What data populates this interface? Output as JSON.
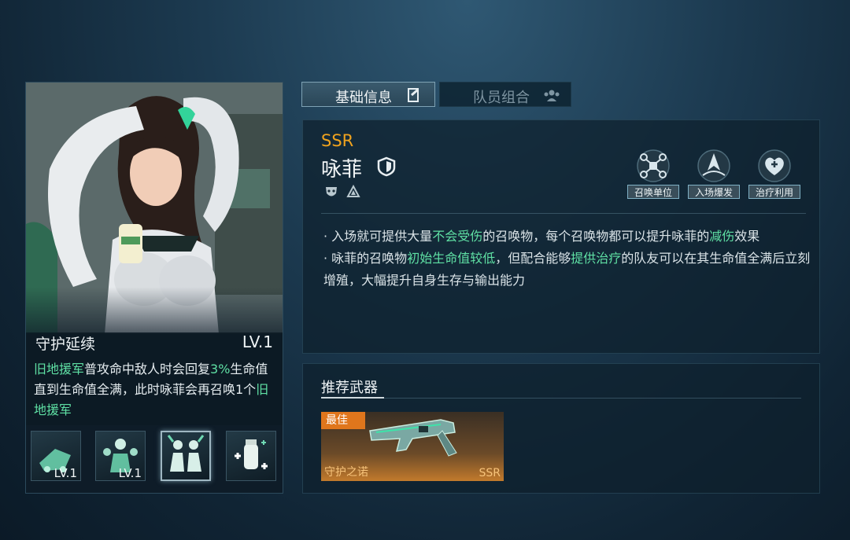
{
  "tabs": [
    {
      "label": "基础信息",
      "icon": "document-edit-icon",
      "active": true
    },
    {
      "label": "队员组合",
      "icon": "team-icon",
      "active": false
    }
  ],
  "character": {
    "rarity": "SSR",
    "name": "咏菲",
    "class_icon": "shield-icon",
    "attribute_icons": [
      "mask-icon",
      "triangle-emblem-icon"
    ],
    "tags": [
      {
        "label": "召唤单位",
        "icon": "drone-icon"
      },
      {
        "label": "入场爆发",
        "icon": "burst-icon"
      },
      {
        "label": "治疗利用",
        "icon": "heart-cross-icon"
      }
    ],
    "description": [
      [
        {
          "t": "· 入场就可提供大量",
          "hl": false
        },
        {
          "t": "不会受伤",
          "hl": true
        },
        {
          "t": "的召唤物，每个召唤物都可以提升咏菲的",
          "hl": false
        },
        {
          "t": "减伤",
          "hl": true
        },
        {
          "t": "效果",
          "hl": false
        }
      ],
      [
        {
          "t": "· 咏菲的召唤物",
          "hl": false
        },
        {
          "t": "初始生命值较低",
          "hl": true
        },
        {
          "t": "，但配合能够",
          "hl": false
        },
        {
          "t": "提供治疗",
          "hl": true
        },
        {
          "t": "的队友可以在其生命值全满后立刻增殖，大幅提升自身生存与输出能力",
          "hl": false
        }
      ]
    ]
  },
  "skill": {
    "name": "守护延续",
    "level": "LV.1",
    "description": [
      {
        "t": "旧地援军",
        "hl": true
      },
      {
        "t": "普攻命中敌人时会回复",
        "hl": false
      },
      {
        "t": "3%",
        "hl": true
      },
      {
        "t": "生命值直到生命值全满，此时咏菲会再召唤1个",
        "hl": false
      },
      {
        "t": "旧地援军",
        "hl": true
      }
    ],
    "icons": [
      {
        "name": "vehicle-skill-icon",
        "level": "LV.1",
        "selected": false
      },
      {
        "name": "squad-skill-icon",
        "level": "LV.1",
        "selected": false
      },
      {
        "name": "reinforcement-skill-icon",
        "level": "",
        "selected": true
      },
      {
        "name": "heal-bottle-skill-icon",
        "level": "",
        "selected": false
      }
    ]
  },
  "weapon": {
    "heading": "推荐武器",
    "badge": "最佳",
    "name": "守护之诺",
    "rarity": "SSR"
  },
  "colors": {
    "rarity": "#f0a31e",
    "highlight": "#5fe0a4",
    "best_badge": "#e0761c"
  }
}
